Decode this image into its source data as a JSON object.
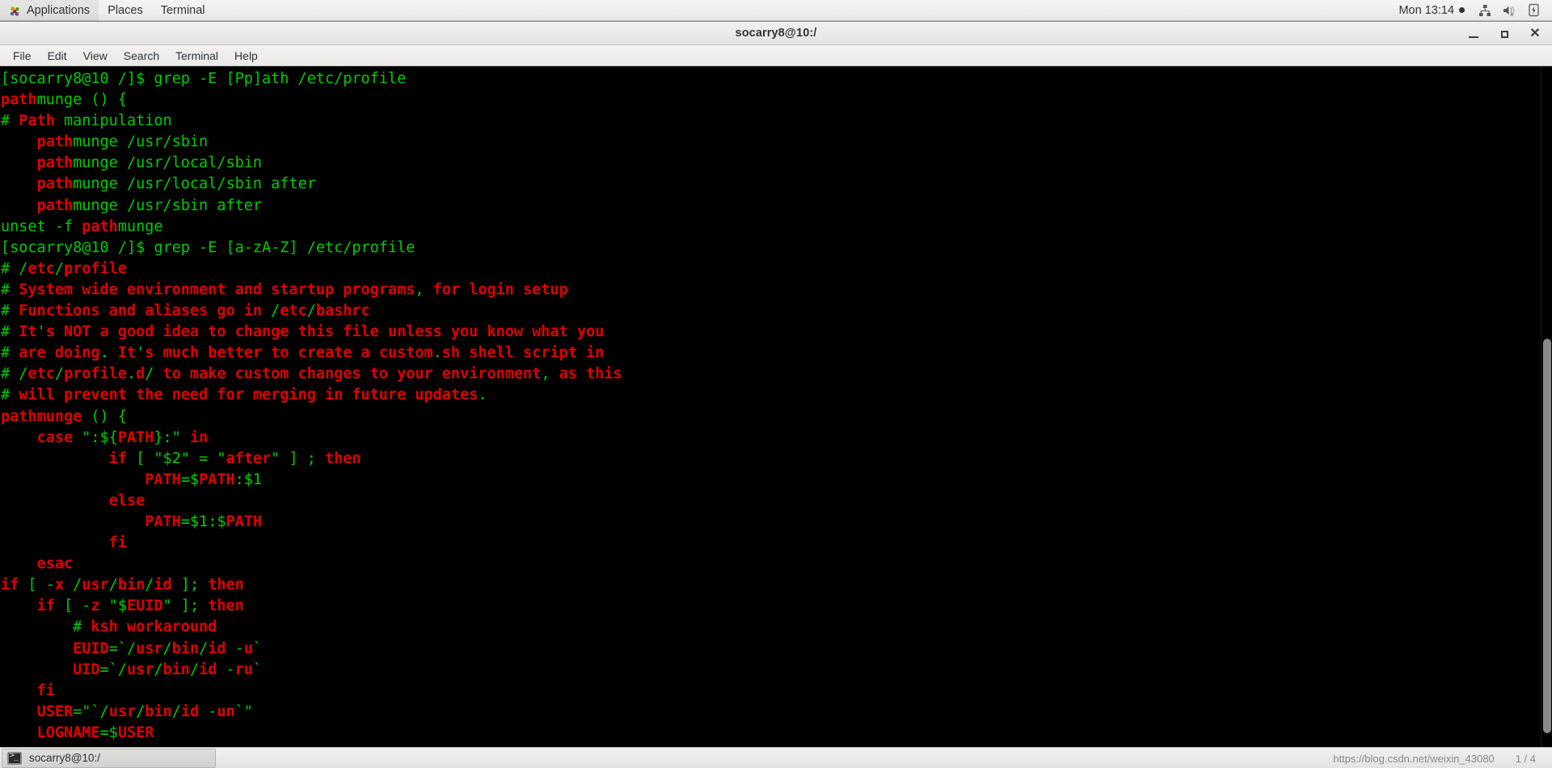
{
  "desktop": {
    "panel": {
      "logo_icon": "fedora-logo-icon",
      "menus": [
        {
          "label": "Applications",
          "name": "applications-menu"
        },
        {
          "label": "Places",
          "name": "places-menu"
        },
        {
          "label": "Terminal",
          "name": "terminal-menu"
        }
      ],
      "tray": {
        "clock": "Mon 13:14",
        "indicator_dot": "●",
        "icons": [
          "network-icon",
          "volume-muted-icon",
          "battery-charging-icon"
        ]
      }
    },
    "taskbar": {
      "buttons": [
        {
          "label": "socarry8@10:/",
          "icon": "terminal-icon"
        }
      ],
      "watermark": [
        "https://blog.csdn.net/weixin_43080",
        "1 / 4"
      ]
    }
  },
  "window": {
    "title": "socarry8@10:/",
    "controls": {
      "minimize": "minimize-button",
      "maximize": "maximize-button",
      "close": "close-button"
    },
    "menubar": [
      {
        "label": "File",
        "name": "menu-file"
      },
      {
        "label": "Edit",
        "name": "menu-edit"
      },
      {
        "label": "View",
        "name": "menu-view"
      },
      {
        "label": "Search",
        "name": "menu-search"
      },
      {
        "label": "Terminal",
        "name": "menu-terminal"
      },
      {
        "label": "Help",
        "name": "menu-help"
      }
    ]
  },
  "colors": {
    "green": "#00cc00",
    "match_red": "#e00000",
    "background": "#000000",
    "panel": "#eeeeec"
  },
  "terminal": {
    "prompt": "[socarry8@10 /]$ ",
    "commands": [
      "grep -E [Pp]ath /etc/profile",
      "grep -E [a-zA-Z] /etc/profile"
    ],
    "lines": [
      [
        [
          "g",
          "[socarry8@10 /]$ grep -E [Pp]ath /etc/profile"
        ]
      ],
      [
        [
          "r",
          "path"
        ],
        [
          "g",
          "munge () {"
        ]
      ],
      [
        [
          "g",
          "# "
        ],
        [
          "r",
          "Path"
        ],
        [
          "g",
          " manipulation"
        ]
      ],
      [
        [
          "g",
          "    "
        ],
        [
          "r",
          "path"
        ],
        [
          "g",
          "munge /usr/sbin"
        ]
      ],
      [
        [
          "g",
          "    "
        ],
        [
          "r",
          "path"
        ],
        [
          "g",
          "munge /usr/local/sbin"
        ]
      ],
      [
        [
          "g",
          "    "
        ],
        [
          "r",
          "path"
        ],
        [
          "g",
          "munge /usr/local/sbin after"
        ]
      ],
      [
        [
          "g",
          "    "
        ],
        [
          "r",
          "path"
        ],
        [
          "g",
          "munge /usr/sbin after"
        ]
      ],
      [
        [
          "g",
          "unset -f "
        ],
        [
          "r",
          "path"
        ],
        [
          "g",
          "munge"
        ]
      ],
      [
        [
          "g",
          "[socarry8@10 /]$ grep -E [a-zA-Z] /etc/profile"
        ]
      ],
      [
        [
          "g",
          "# /"
        ],
        [
          "r",
          "etc"
        ],
        [
          "g",
          "/"
        ],
        [
          "r",
          "profile"
        ]
      ],
      [
        [
          "g",
          "# "
        ],
        [
          "r",
          "System wide environment and startup programs"
        ],
        [
          "g",
          ", "
        ],
        [
          "r",
          "for login setup"
        ]
      ],
      [
        [
          "g",
          "# "
        ],
        [
          "r",
          "Functions and aliases go in"
        ],
        [
          "g",
          " /"
        ],
        [
          "r",
          "etc"
        ],
        [
          "g",
          "/"
        ],
        [
          "r",
          "bashrc"
        ]
      ],
      [
        [
          "g",
          "# "
        ],
        [
          "r",
          "It"
        ],
        [
          "g",
          "'"
        ],
        [
          "r",
          "s NOT a good idea to change this file unless you know what you"
        ]
      ],
      [
        [
          "g",
          "# "
        ],
        [
          "r",
          "are doing"
        ],
        [
          "g",
          "."
        ],
        [
          "r",
          " It"
        ],
        [
          "g",
          "'"
        ],
        [
          "r",
          "s much better to create a custom"
        ],
        [
          "g",
          "."
        ],
        [
          "r",
          "sh shell script in"
        ]
      ],
      [
        [
          "g",
          "# /"
        ],
        [
          "r",
          "etc"
        ],
        [
          "g",
          "/"
        ],
        [
          "r",
          "profile"
        ],
        [
          "g",
          "."
        ],
        [
          "r",
          "d"
        ],
        [
          "g",
          "/ "
        ],
        [
          "r",
          "to make custom changes to your environment"
        ],
        [
          "g",
          ", "
        ],
        [
          "r",
          "as this"
        ]
      ],
      [
        [
          "g",
          "# "
        ],
        [
          "r",
          "will prevent the need for merging in future updates"
        ],
        [
          "g",
          "."
        ]
      ],
      [
        [
          "r",
          "pathmunge"
        ],
        [
          "g",
          " () {"
        ]
      ],
      [
        [
          "g",
          "    "
        ],
        [
          "r",
          "case"
        ],
        [
          "g",
          " \":${"
        ],
        [
          "r",
          "PATH"
        ],
        [
          "g",
          "}:\" "
        ],
        [
          "r",
          "in"
        ]
      ],
      [
        [
          "g",
          "            "
        ],
        [
          "r",
          "if"
        ],
        [
          "g",
          " [ \"$2\" = \""
        ],
        [
          "r",
          "after"
        ],
        [
          "g",
          "\" ] ; "
        ],
        [
          "r",
          "then"
        ]
      ],
      [
        [
          "g",
          "                "
        ],
        [
          "r",
          "PATH"
        ],
        [
          "g",
          "=$"
        ],
        [
          "r",
          "PATH"
        ],
        [
          "g",
          ":$1"
        ]
      ],
      [
        [
          "g",
          "            "
        ],
        [
          "r",
          "else"
        ]
      ],
      [
        [
          "g",
          "                "
        ],
        [
          "r",
          "PATH"
        ],
        [
          "g",
          "=$1:$"
        ],
        [
          "r",
          "PATH"
        ]
      ],
      [
        [
          "g",
          "            "
        ],
        [
          "r",
          "fi"
        ]
      ],
      [
        [
          "g",
          "    "
        ],
        [
          "r",
          "esac"
        ]
      ],
      [
        [
          "r",
          "if"
        ],
        [
          "g",
          " [ -"
        ],
        [
          "r",
          "x"
        ],
        [
          "g",
          " /"
        ],
        [
          "r",
          "usr"
        ],
        [
          "g",
          "/"
        ],
        [
          "r",
          "bin"
        ],
        [
          "g",
          "/"
        ],
        [
          "r",
          "id"
        ],
        [
          "g",
          " ]; "
        ],
        [
          "r",
          "then"
        ]
      ],
      [
        [
          "g",
          "    "
        ],
        [
          "r",
          "if"
        ],
        [
          "g",
          " [ -"
        ],
        [
          "r",
          "z"
        ],
        [
          "g",
          " \"$"
        ],
        [
          "r",
          "EUID"
        ],
        [
          "g",
          "\" ]; "
        ],
        [
          "r",
          "then"
        ]
      ],
      [
        [
          "g",
          "        # "
        ],
        [
          "r",
          "ksh workaround"
        ]
      ],
      [
        [
          "g",
          "        "
        ],
        [
          "r",
          "EUID"
        ],
        [
          "g",
          "=`/"
        ],
        [
          "r",
          "usr"
        ],
        [
          "g",
          "/"
        ],
        [
          "r",
          "bin"
        ],
        [
          "g",
          "/"
        ],
        [
          "r",
          "id"
        ],
        [
          "g",
          " -"
        ],
        [
          "r",
          "u"
        ],
        [
          "g",
          "`"
        ]
      ],
      [
        [
          "g",
          "        "
        ],
        [
          "r",
          "UID"
        ],
        [
          "g",
          "=`/"
        ],
        [
          "r",
          "usr"
        ],
        [
          "g",
          "/"
        ],
        [
          "r",
          "bin"
        ],
        [
          "g",
          "/"
        ],
        [
          "r",
          "id"
        ],
        [
          "g",
          " -"
        ],
        [
          "r",
          "ru"
        ],
        [
          "g",
          "`"
        ]
      ],
      [
        [
          "g",
          "    "
        ],
        [
          "r",
          "fi"
        ]
      ],
      [
        [
          "g",
          "    "
        ],
        [
          "r",
          "USER"
        ],
        [
          "g",
          "=\"`/"
        ],
        [
          "r",
          "usr"
        ],
        [
          "g",
          "/"
        ],
        [
          "r",
          "bin"
        ],
        [
          "g",
          "/"
        ],
        [
          "r",
          "id"
        ],
        [
          "g",
          " -"
        ],
        [
          "r",
          "un"
        ],
        [
          "g",
          "`\""
        ]
      ],
      [
        [
          "g",
          "    "
        ],
        [
          "r",
          "LOGNAME"
        ],
        [
          "g",
          "=$"
        ],
        [
          "r",
          "USER"
        ]
      ]
    ],
    "scrollbar": {
      "thumb_top_pct": 40,
      "thumb_height_pct": 58
    }
  }
}
